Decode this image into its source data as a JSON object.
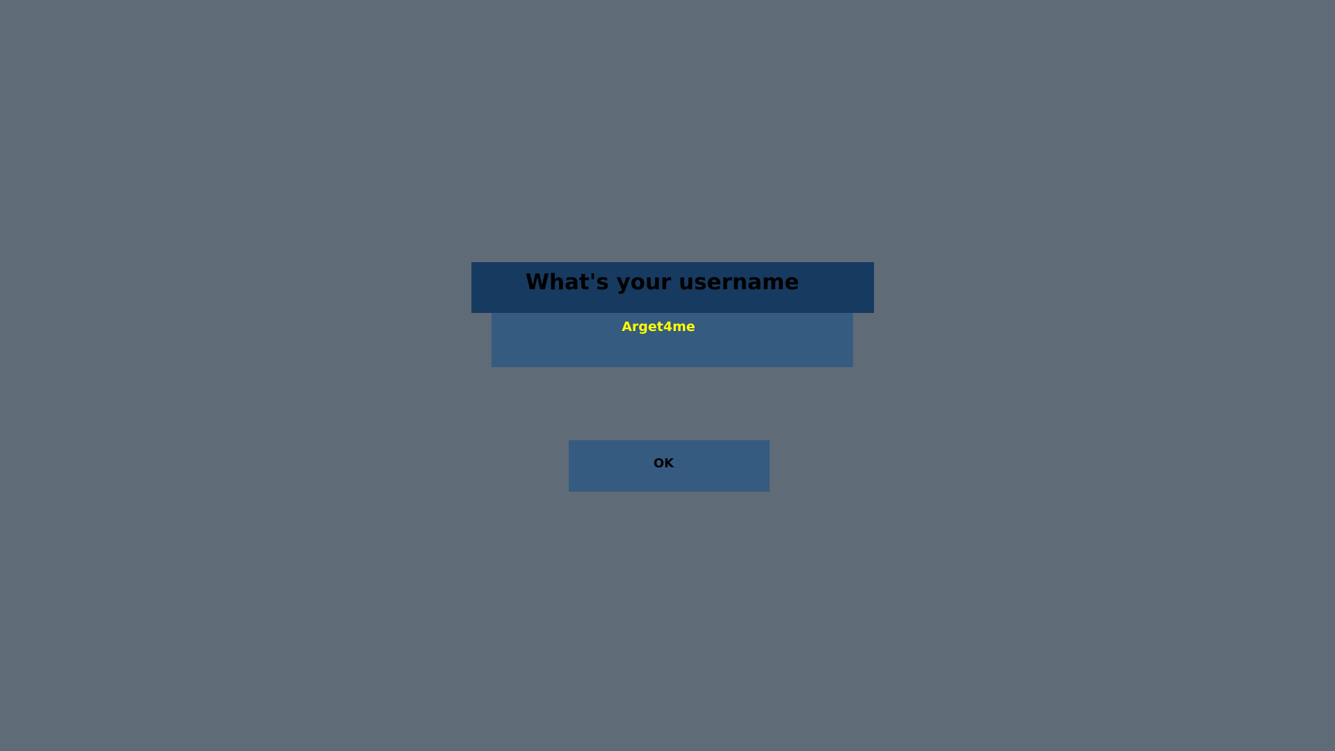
{
  "dialog": {
    "title": "What's your username",
    "username_value": "Arget4me",
    "ok_label": "OK"
  },
  "colors": {
    "background": "#5f6b76",
    "header": "#173a60",
    "input": "#365b80",
    "button": "#365b80",
    "input_text": "#ffff00",
    "text": "#000000"
  }
}
